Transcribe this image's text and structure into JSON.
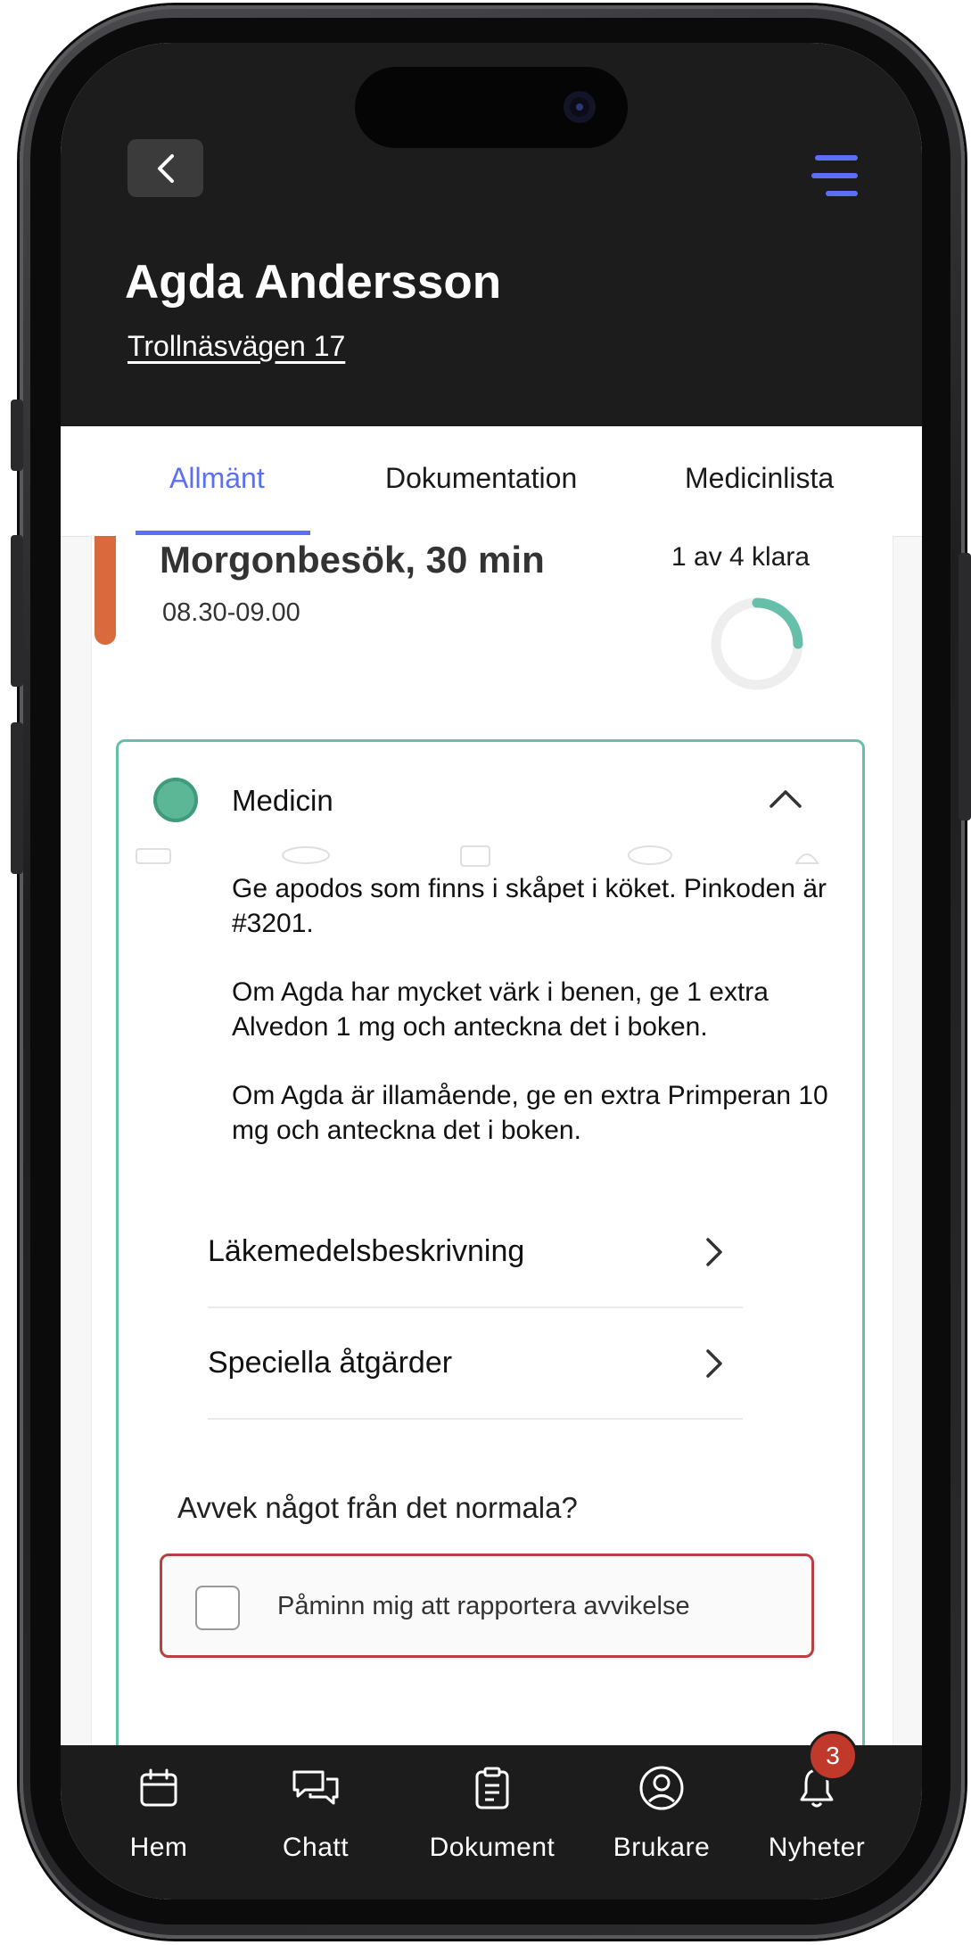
{
  "header": {
    "user_name": "Agda Andersson",
    "address": "Trollnäsvägen 17"
  },
  "tabs": [
    {
      "label": "Allmänt",
      "active": true
    },
    {
      "label": "Dokumentation",
      "active": false
    },
    {
      "label": "Medicinlista",
      "active": false
    }
  ],
  "visit": {
    "title": "Morgonbesök, 30 min",
    "time": "08.30-09.00",
    "progress_label": "1 av 4 klara",
    "progress_fraction": 0.25,
    "accent_color": "#D86A3D",
    "progress_color": "#66BFA9"
  },
  "task": {
    "title": "Medicin",
    "status_color": "#5CB797",
    "description": [
      "Ge apodos som finns i skåpet i köket. Pinkoden är #3201.",
      "Om Agda har mycket värk i benen, ge 1 extra Alvedon 1 mg och anteckna det i boken.",
      "Om Agda är illamående, ge en extra Primperan 10 mg och anteckna det i boken."
    ],
    "links": [
      {
        "label": "Läkemedelsbeskrivning"
      },
      {
        "label": "Speciella åtgärder"
      }
    ],
    "deviation_question": "Avvek något från det normala?",
    "reminder_label": "Påminn mig att rapportera avvikelse",
    "reminder_checked": false
  },
  "bottom_nav": {
    "items": [
      {
        "label": "Hem",
        "icon": "calendar-icon"
      },
      {
        "label": "Chatt",
        "icon": "chat-icon"
      },
      {
        "label": "Dokument",
        "icon": "clipboard-icon"
      },
      {
        "label": "Brukare",
        "icon": "user-circle-icon"
      },
      {
        "label": "Nyheter",
        "icon": "bell-icon"
      }
    ],
    "notification_count": "3"
  },
  "colors": {
    "accent_blue": "#5B6FF5",
    "header_bg": "#1C1C1C",
    "badge_red": "#C0392B",
    "alert_border": "#B84040"
  }
}
